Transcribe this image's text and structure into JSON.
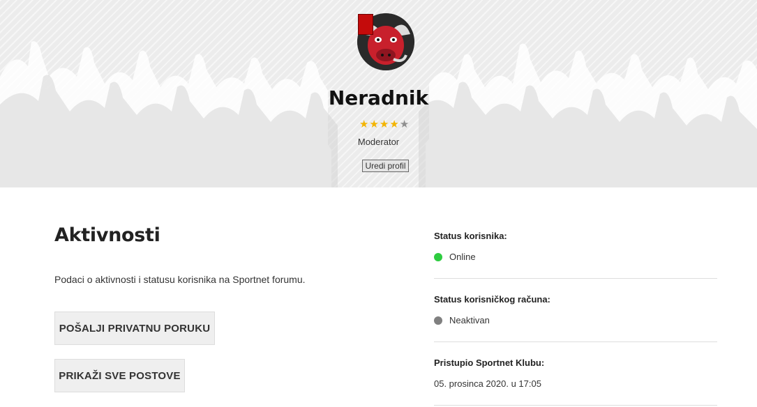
{
  "profile": {
    "username": "Neradnik",
    "rating": 4,
    "rating_max": 5,
    "role": "Moderator",
    "edit_label": "Uredi profil"
  },
  "activity": {
    "title": "Aktivnosti",
    "description": "Podaci o aktivnosti i statusu korisnika na Sportnet forumu.",
    "send_message_label": "POŠALJI PRIVATNU PORUKU",
    "show_posts_label": "PRIKAŽI SVE POSTOVE"
  },
  "status": {
    "user_status_label": "Status korisnika:",
    "user_status_value": "Online",
    "user_status_color": "#2ecc40",
    "account_status_label": "Status korisničkog računa:",
    "account_status_value": "Neaktivan",
    "account_status_color": "#808080",
    "joined_label": "Pristupio Sportnet Klubu:",
    "joined_value": "05. prosinca 2020. u 17:05"
  },
  "colors": {
    "star_on": "#f3b400",
    "star_off": "#8f8f8f",
    "avatar_flag": "#c40b0b"
  }
}
